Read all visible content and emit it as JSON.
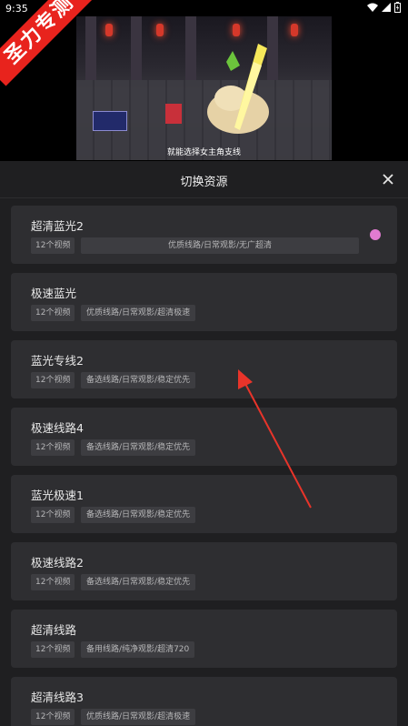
{
  "status": {
    "time": "9:35"
  },
  "video": {
    "subtitle": "就能选择女主角支线"
  },
  "watermark": {
    "text": "圣力专测"
  },
  "sheet": {
    "title": "切换资源"
  },
  "sources": [
    {
      "name": "超清蓝光2",
      "count": "12个视频",
      "desc": "优质线路/日常观影/无广超清",
      "selected": true
    },
    {
      "name": "极速蓝光",
      "count": "12个视频",
      "desc": "优质线路/日常观影/超清极速"
    },
    {
      "name": "蓝光专线2",
      "count": "12个视频",
      "desc": "备选线路/日常观影/稳定优先"
    },
    {
      "name": "极速线路4",
      "count": "12个视频",
      "desc": "备选线路/日常观影/稳定优先"
    },
    {
      "name": "蓝光极速1",
      "count": "12个视频",
      "desc": "备选线路/日常观影/稳定优先"
    },
    {
      "name": "极速线路2",
      "count": "12个视频",
      "desc": "备选线路/日常观影/稳定优先"
    },
    {
      "name": "超清线路",
      "count": "12个视频",
      "desc": "备用线路/纯净观影/超清720"
    },
    {
      "name": "超清线路3",
      "count": "12个视频",
      "desc": "优质线路/日常观影/超清极速"
    }
  ],
  "colors": {
    "accent": "#e17bd0",
    "watermark": "#e8231d",
    "arrow": "#e8342a"
  }
}
